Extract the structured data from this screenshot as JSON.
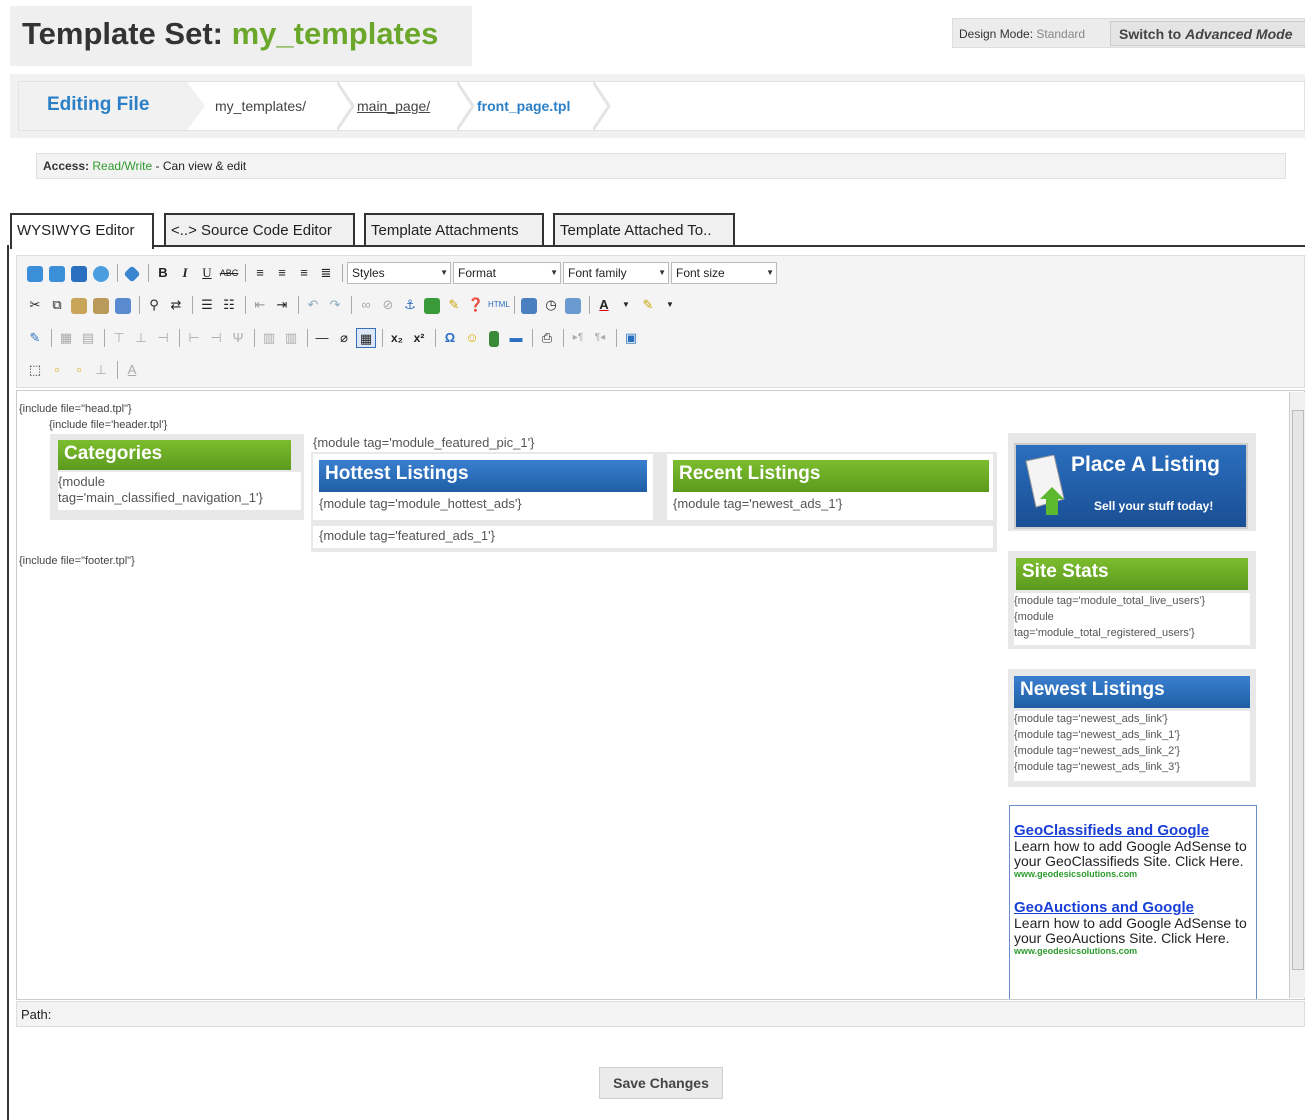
{
  "header": {
    "title_prefix": "Template Set: ",
    "title_set": "my_templates",
    "design_mode_label": "Design Mode: ",
    "design_mode_value": "Standard",
    "switch_prefix": "Switch to ",
    "switch_italic": "Advanced Mode"
  },
  "breadcrumb": {
    "editing_label": "Editing File",
    "items": [
      "my_templates/",
      "main_page/",
      "front_page.tpl"
    ]
  },
  "access": {
    "label": "Access: ",
    "value": "Read/Write",
    "suffix": " - Can view & edit"
  },
  "tabs": [
    {
      "label": "WYSIWYG Editor"
    },
    {
      "label": "<..> Source Code Editor"
    },
    {
      "label": "Template Attachments"
    },
    {
      "label": "Template Attached To.."
    }
  ],
  "toolbar": {
    "styles": "Styles",
    "format": "Format",
    "font_family": "Font family",
    "font_size": "Font size"
  },
  "editor": {
    "include_head": "{include file=\"head.tpl\"}",
    "include_header": "{include file='header.tpl'}",
    "include_footer": "{include file=\"footer.tpl\"}",
    "categories_title": "Categories",
    "categories_code": "{module tag='main_classified_navigation_1'}",
    "featured_pic": "{module tag='module_featured_pic_1'}",
    "hottest_title": "Hottest Listings",
    "hottest_code": "{module tag='module_hottest_ads'}",
    "recent_title": "Recent Listings",
    "recent_code": "{module tag='newest_ads_1'}",
    "featured_ads": "{module tag='featured_ads_1'}",
    "place_title": "Place A Listing",
    "place_sub": "Sell your stuff today!",
    "stats_title": "Site Stats",
    "stats_lines": [
      "{module tag='module_total_live_users'}",
      "{module",
      "tag='module_total_registered_users'}"
    ],
    "newest_title": "Newest Listings",
    "newest_lines": [
      "{module tag='newest_ads_link'}",
      "{module tag='newest_ads_link_1'}",
      "{module tag='newest_ads_link_2'}",
      "{module tag='newest_ads_link_3'}"
    ],
    "ads": [
      {
        "title": "GeoClassifieds and Google",
        "body": "Learn how to add Google AdSense to your GeoClassifieds Site. Click Here.",
        "url": "www.geodesicsolutions.com"
      },
      {
        "title": "GeoAuctions and Google",
        "body": "Learn how to add Google AdSense to your GeoAuctions Site. Click Here.",
        "url": "www.geodesicsolutions.com"
      }
    ]
  },
  "path_label": "Path:",
  "save_label": "Save Changes"
}
